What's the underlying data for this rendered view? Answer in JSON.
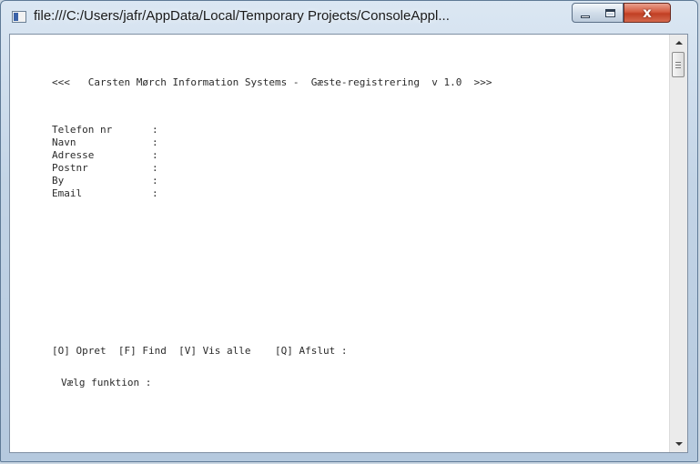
{
  "window": {
    "title": "file:///C:/Users/jafr/AppData/Local/Temporary Projects/ConsoleAppl...",
    "icons": {
      "app": "console-app-icon",
      "minimize": "minimize-icon",
      "maximize": "maximize-icon",
      "close": "close-icon"
    },
    "close_glyph": "x",
    "colors": {
      "close_button": "#c94a2e",
      "titlebar": "#c3d4e6"
    }
  },
  "console": {
    "header": "<<<   Carsten Mørch Information Systems -  Gæste-registrering  v 1.0  >>>",
    "fields": [
      {
        "label": "Telefon nr",
        "sep": ":"
      },
      {
        "label": "Navn",
        "sep": ":"
      },
      {
        "label": "Adresse",
        "sep": ":"
      },
      {
        "label": "Postnr",
        "sep": ":"
      },
      {
        "label": "By",
        "sep": ":"
      },
      {
        "label": "Email",
        "sep": ":"
      }
    ],
    "menu": "[O] Opret  [F] Find  [V] Vis alle    [Q] Afslut :",
    "prompt": "Vælg funktion :"
  }
}
